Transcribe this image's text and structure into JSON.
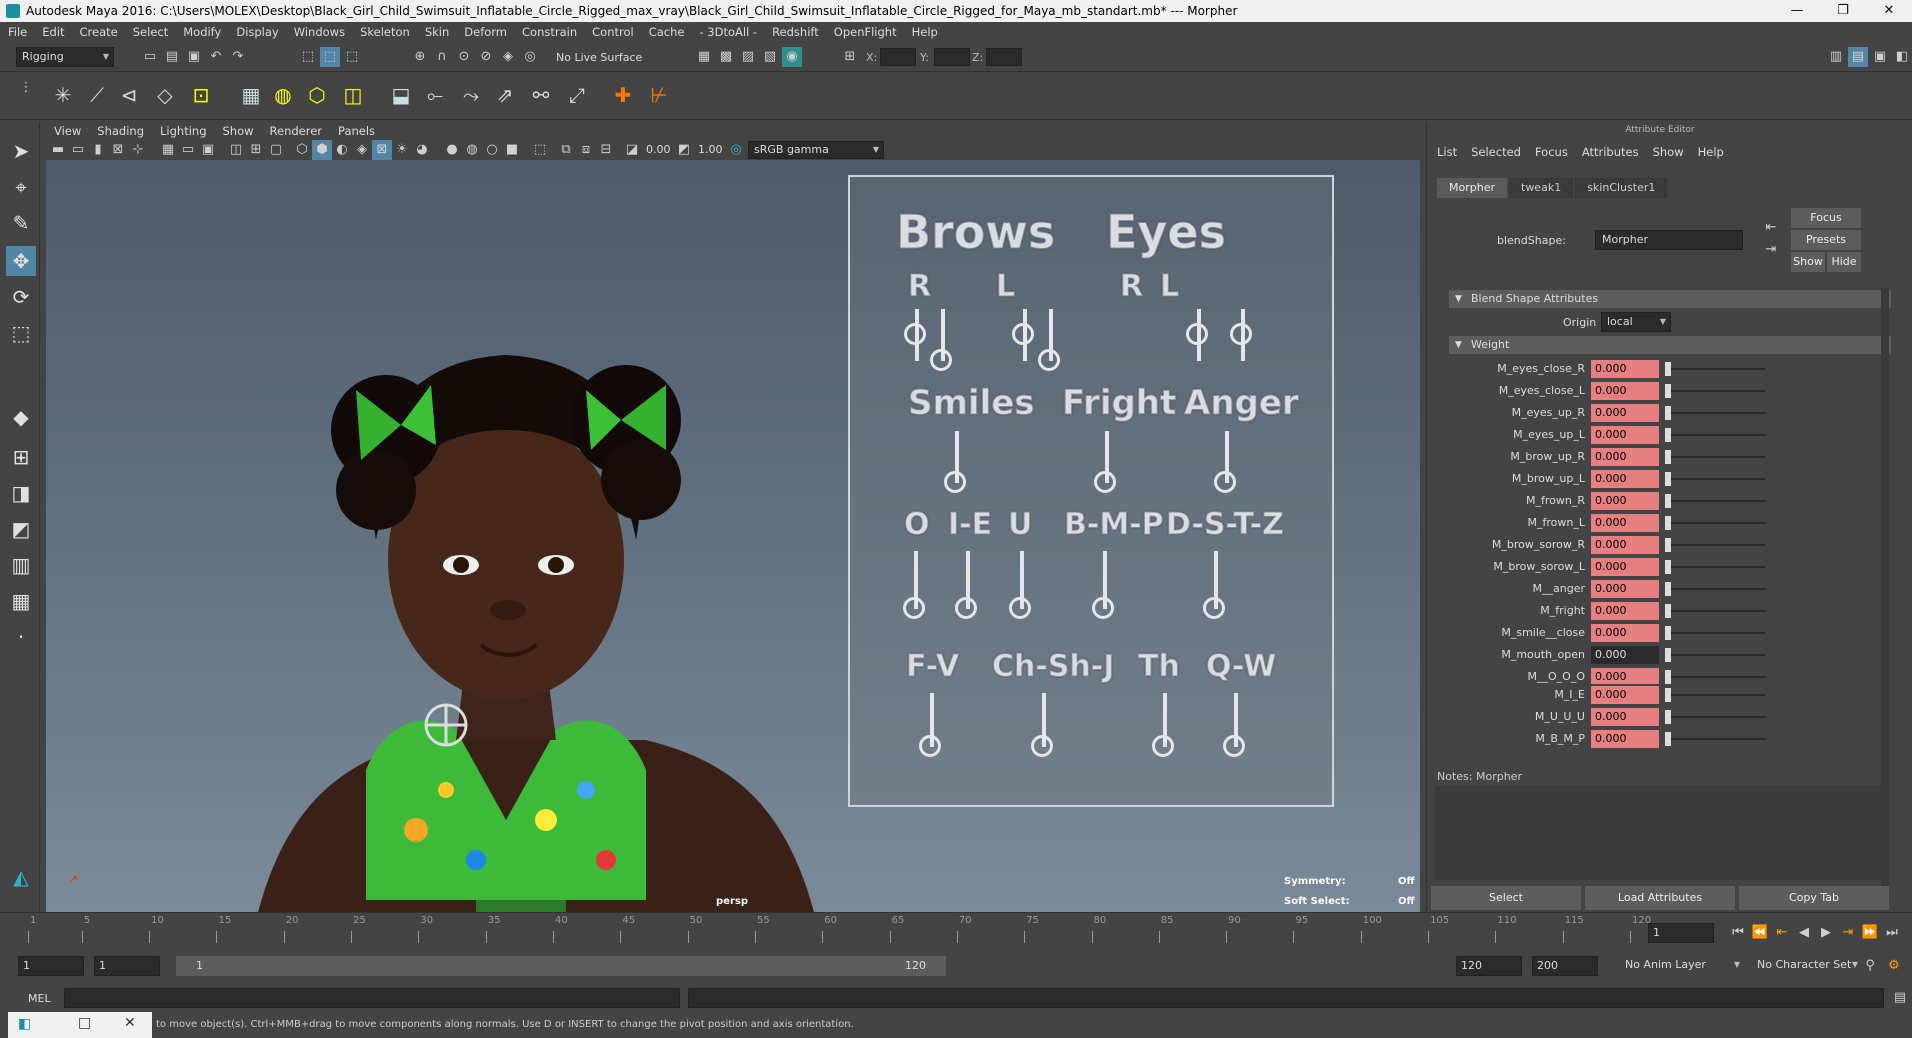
{
  "titlebar": {
    "title": "Autodesk Maya 2016: C:\\Users\\MOLEX\\Desktop\\Black_Girl_Child_Swimsuit_Inflatable_Circle_Rigged_max_vray\\Black_Girl_Child_Swimsuit_Inflatable_Circle_Rigged_for_Maya_mb_standart.mb*  ---  Morpher",
    "minimize": "—",
    "maximize": "❐",
    "close": "✕"
  },
  "menubar": [
    "File",
    "Edit",
    "Create",
    "Select",
    "Modify",
    "Display",
    "Windows",
    "Skeleton",
    "Skin",
    "Deform",
    "Constrain",
    "Control",
    "Cache",
    "- 3DtoAll -",
    "Redshift",
    "OpenFlight",
    "Help"
  ],
  "statusline": {
    "menuset": "Rigging",
    "live_surface": "No Live Surface",
    "x_label": "X:",
    "y_label": "Y:",
    "z_label": "Z:"
  },
  "panel": {
    "menu": [
      "View",
      "Shading",
      "Lighting",
      "Show",
      "Renderer",
      "Panels"
    ],
    "exposure": "0.00",
    "gamma": "1.00",
    "colorspace": "sRGB gamma",
    "camera": "persp",
    "symmetry_label": "Symmetry:",
    "symmetry_value": "Off",
    "softselect_label": "Soft Select:",
    "softselect_value": "Off"
  },
  "facepanel": {
    "brows": "Brows",
    "eyes": "Eyes",
    "r1": "R",
    "l1": "L",
    "r2": "R",
    "l2": "L",
    "smiles": "Smiles",
    "fright": "Fright",
    "anger": "Anger",
    "o": "O",
    "ie": "I-E",
    "u": "U",
    "bmp": "B-M-P",
    "dstz": "D-S-T-Z",
    "fv": "F-V",
    "chshj": "Ch-Sh-J",
    "th": "Th",
    "qw": "Q-W"
  },
  "attribute_editor": {
    "title": "Attribute Editor",
    "menu": [
      "List",
      "Selected",
      "Focus",
      "Attributes",
      "Show",
      "Help"
    ],
    "tabs": [
      "Morpher",
      "tweak1",
      "skinCluster1"
    ],
    "blendshape_label": "blendShape:",
    "blendshape_value": "Morpher",
    "focus_btn": "Focus",
    "presets_btn": "Presets",
    "show_btn": "Show",
    "hide_btn": "Hide",
    "section_blend": "Blend Shape Attributes",
    "origin_label": "Origin",
    "origin_value": "local",
    "section_weight": "Weight",
    "weights": [
      {
        "name": "M_eyes_close_R",
        "value": "0.000"
      },
      {
        "name": "M_eyes_close_L",
        "value": "0.000"
      },
      {
        "name": "M_eyes_up_R",
        "value": "0.000"
      },
      {
        "name": "M_eyes_up_L",
        "value": "0.000"
      },
      {
        "name": "M_brow_up_R",
        "value": "0.000"
      },
      {
        "name": "M_brow_up_L",
        "value": "0.000"
      },
      {
        "name": "M_frown_R",
        "value": "0.000"
      },
      {
        "name": "M_frown_L",
        "value": "0.000"
      },
      {
        "name": "M_brow_sorow_R",
        "value": "0.000"
      },
      {
        "name": "M_brow_sorow_L",
        "value": "0.000"
      },
      {
        "name": "M__anger",
        "value": "0.000"
      },
      {
        "name": "M_fright",
        "value": "0.000"
      },
      {
        "name": "M_smile__close",
        "value": "0.000"
      },
      {
        "name": "M_mouth_open",
        "value": "0.000"
      },
      {
        "name": "M__O_O_O",
        "value": "0.000"
      },
      {
        "name": "M_I_E",
        "value": "0.000"
      },
      {
        "name": "M_U_U_U",
        "value": "0.000"
      },
      {
        "name": "M_B_M_P",
        "value": "0.000"
      }
    ],
    "notes_label": "Notes:",
    "notes_value": "Morpher",
    "select_btn": "Select",
    "load_btn": "Load Attributes",
    "copy_btn": "Copy Tab"
  },
  "timeline": {
    "ticks": [
      "1",
      "5",
      "10",
      "15",
      "20",
      "25",
      "30",
      "35",
      "40",
      "45",
      "50",
      "55",
      "60",
      "65",
      "70",
      "75",
      "80",
      "85",
      "90",
      "95",
      "100",
      "105",
      "110",
      "115",
      "120"
    ],
    "current_frame": "1"
  },
  "rangebar": {
    "start": "1",
    "playback_start": "1",
    "slider_start": "1",
    "slider_end": "120",
    "playback_end": "120",
    "end": "200",
    "anim_layer": "No Anim Layer",
    "char_set": "No Character Set"
  },
  "cmdline": {
    "label": "MEL"
  },
  "helpline": {
    "text": "to move object(s). Ctrl+MMB+drag to move components along normals. Use D or INSERT to change the pivot position and axis orientation."
  }
}
